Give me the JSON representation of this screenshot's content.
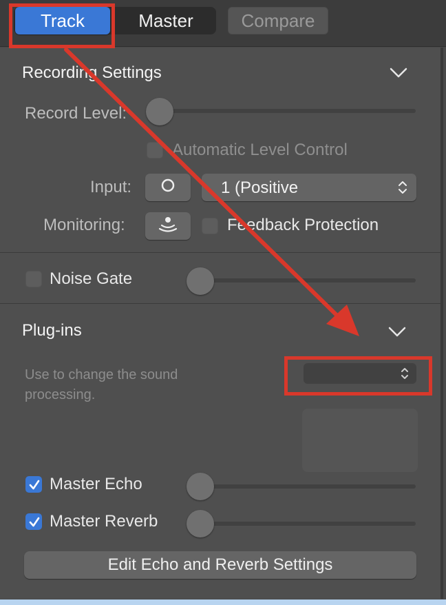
{
  "tabs": {
    "track": "Track",
    "master": "Master",
    "compare": "Compare"
  },
  "recording": {
    "title": "Recording Settings",
    "record_level_label": "Record Level:",
    "record_level": 0,
    "auto_level_label": "Automatic Level Control",
    "auto_level_checked": false,
    "input_label": "Input:",
    "input_value": "1  (Positive",
    "monitoring_label": "Monitoring:",
    "feedback_label": "Feedback Protection",
    "feedback_checked": false
  },
  "noise_gate": {
    "label": "Noise Gate",
    "checked": false,
    "level": 0
  },
  "plugins": {
    "title": "Plug-ins",
    "helper": "Use to change the sound processing.",
    "selected": ""
  },
  "master_echo": {
    "label": "Master Echo",
    "checked": true,
    "level": 0
  },
  "master_reverb": {
    "label": "Master Reverb",
    "checked": true,
    "level": 0
  },
  "edit_button": "Edit Echo and Reverb Settings",
  "colors": {
    "accent": "#3a78d6",
    "annotation": "#d9382b"
  },
  "icons": [
    "chevron-down-icon",
    "input-ring-icon",
    "monitoring-icon",
    "up-down-icon",
    "checkmark-icon"
  ]
}
